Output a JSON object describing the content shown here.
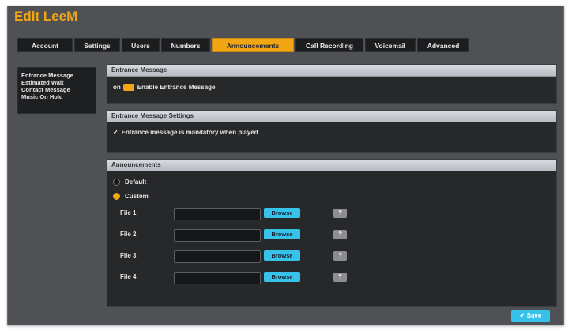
{
  "window": {
    "title": "Edit LeeM"
  },
  "tabs": [
    {
      "label": "Account"
    },
    {
      "label": "Settings"
    },
    {
      "label": "Users"
    },
    {
      "label": "Numbers"
    },
    {
      "label": "Announcements"
    },
    {
      "label": "Call Recording"
    },
    {
      "label": "Voicemail"
    },
    {
      "label": "Advanced"
    }
  ],
  "active_tab": "Announcements",
  "sidebar": {
    "items": [
      {
        "label": "Entrance Message"
      },
      {
        "label": "Estimated Wait"
      },
      {
        "label": "Contact Message"
      },
      {
        "label": "Music On Hold"
      }
    ]
  },
  "entrance_message": {
    "header": "Entrance Message",
    "toggle_state": "on",
    "toggle_label": "Enable Entrance Message"
  },
  "entrance_settings": {
    "header": "Entrance Message Settings",
    "check_mark": "✓",
    "mandatory_label": "Entrance message is mandatory when played"
  },
  "announcements": {
    "header": "Announcements",
    "default_label": "Default",
    "custom_label": "Custom",
    "selected": "Custom",
    "files": [
      {
        "label": "File 1",
        "value": ""
      },
      {
        "label": "File 2",
        "value": ""
      },
      {
        "label": "File 3",
        "value": ""
      },
      {
        "label": "File 4",
        "value": ""
      }
    ],
    "browse_label": "Browse",
    "help_label": "?"
  },
  "footer": {
    "save_label": "✔ Save"
  },
  "colors": {
    "accent": "#f2a614",
    "button": "#37c2ea",
    "window_bg": "#4f5154",
    "panel_bg": "#27282a"
  }
}
